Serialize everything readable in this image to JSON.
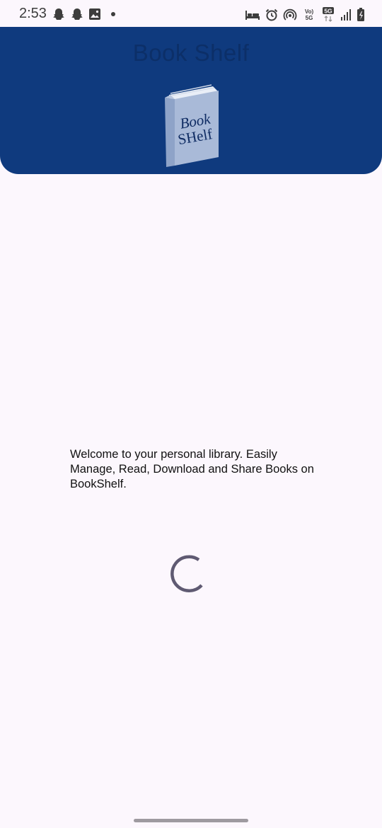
{
  "status_bar": {
    "time": "2:53",
    "left_icons": [
      "snapchat-icon",
      "snapchat-icon",
      "image-icon",
      "notification-dot"
    ],
    "right_icons": [
      "bed-icon",
      "alarm-icon",
      "hotspot-icon",
      "volte-icon",
      "5g-icon",
      "signal-icon",
      "battery-icon"
    ],
    "volte_label": "Vo) 5G",
    "network_label": "5G"
  },
  "header": {
    "title": "Book Shelf",
    "background_color": "#0f3a7e",
    "logo": {
      "line1": "Book",
      "line2": "SHelf",
      "cover_color": "#a9bad8"
    }
  },
  "main": {
    "welcome_text": "Welcome to your personal library. Easily Manage, Read, Download and Share Books on BookShelf."
  },
  "loading": {
    "spinner_color": "#5f5a72"
  }
}
